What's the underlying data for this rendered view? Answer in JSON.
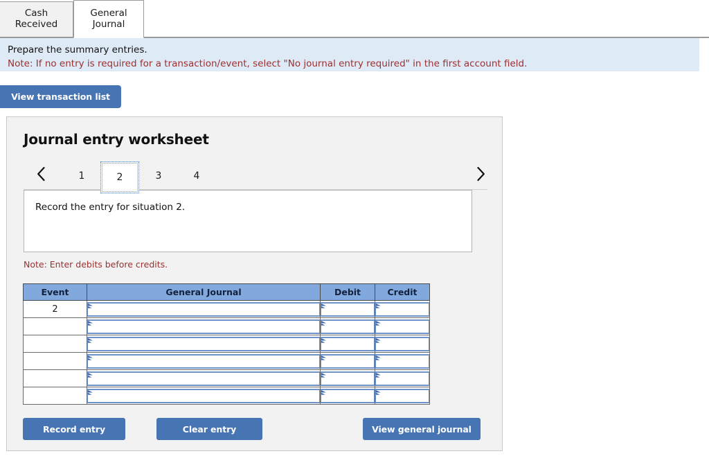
{
  "tabs": [
    {
      "label": "Cash Received",
      "active": false
    },
    {
      "label": "General\nJournal",
      "active": true
    }
  ],
  "banner": {
    "line1": "Prepare the summary entries.",
    "line2": "Note: If no entry is required for a transaction/event, select \"No journal entry required\" in the first account field.",
    "background": "#dfeaf7",
    "note_color": "#9c2f2f"
  },
  "toolbar": {
    "view_transaction_list_label": "View transaction list"
  },
  "worksheet": {
    "title": "Journal entry worksheet",
    "pager": {
      "prev_icon": "chevron-left-icon",
      "next_icon": "chevron-right-icon",
      "pages": [
        "1",
        "2",
        "3",
        "4"
      ],
      "active_page": "2"
    },
    "description": "Record the entry for situation 2.",
    "note": "Note: Enter debits before credits.",
    "table": {
      "headers": [
        "Event",
        "General Journal",
        "Debit",
        "Credit"
      ],
      "rows": [
        {
          "event": "2",
          "account": "",
          "debit": "",
          "credit": ""
        },
        {
          "event": "",
          "account": "",
          "debit": "",
          "credit": ""
        },
        {
          "event": "",
          "account": "",
          "debit": "",
          "credit": ""
        },
        {
          "event": "",
          "account": "",
          "debit": "",
          "credit": ""
        },
        {
          "event": "",
          "account": "",
          "debit": "",
          "credit": ""
        },
        {
          "event": "",
          "account": "",
          "debit": "",
          "credit": ""
        }
      ],
      "header_color": "#82a9dd",
      "input_border_color": "#6e93c8"
    },
    "actions": {
      "record_entry_label": "Record entry",
      "clear_entry_label": "Clear entry",
      "view_general_journal_label": "View general journal"
    },
    "accent_color": "#4774b3",
    "panel_background": "#f2f2f2"
  }
}
